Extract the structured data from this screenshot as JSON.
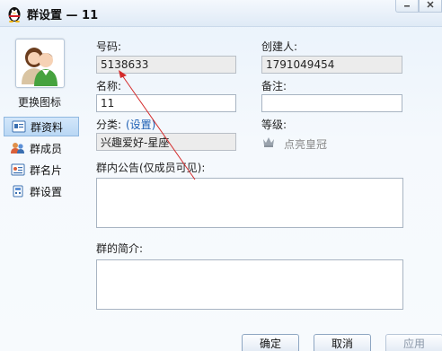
{
  "window": {
    "title": "群设置 — 11"
  },
  "sidebar": {
    "change_icon_label": "更换图标",
    "items": [
      {
        "label": "群资料",
        "icon": "group-info-icon",
        "active": true
      },
      {
        "label": "群成员",
        "icon": "group-members-icon",
        "active": false
      },
      {
        "label": "群名片",
        "icon": "group-card-icon",
        "active": false
      },
      {
        "label": "群设置",
        "icon": "group-settings-icon",
        "active": false
      }
    ]
  },
  "form": {
    "number_label": "号码:",
    "number_value": "5138633",
    "creator_label": "创建人:",
    "creator_value": "1791049454",
    "name_label": "名称:",
    "name_value": "11",
    "remark_label": "备注:",
    "remark_value": "",
    "category_label": "分类:",
    "category_link": "(设置)",
    "category_value": "兴趣爱好-星座",
    "level_label": "等级:",
    "level_value": "点亮皇冠",
    "notice_label": "群内公告(仅成员可见):",
    "intro_label": "群的简介:"
  },
  "buttons": {
    "ok": "确定",
    "cancel": "取消",
    "apply": "应用"
  }
}
